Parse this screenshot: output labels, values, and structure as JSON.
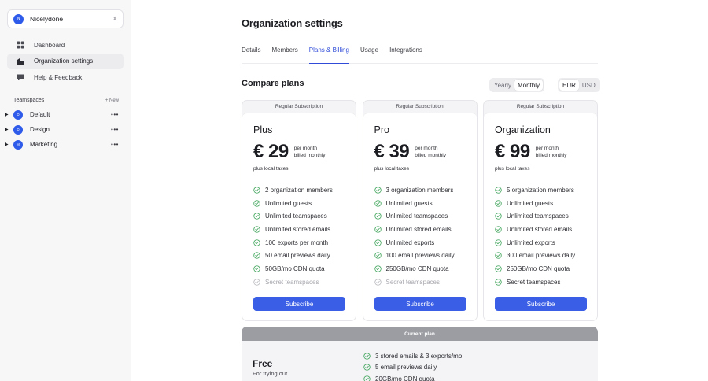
{
  "workspace": {
    "avatar": "N",
    "name": "Nicelydone"
  },
  "nav": [
    {
      "label": "Dashboard",
      "icon": "grid-icon"
    },
    {
      "label": "Organization settings",
      "icon": "building-icon"
    },
    {
      "label": "Help & Feedback",
      "icon": "chat-icon"
    }
  ],
  "teamspaces": {
    "header": "Teamspaces",
    "new_label": "New",
    "items": [
      {
        "badge": "D",
        "label": "Default"
      },
      {
        "badge": "D",
        "label": "Design"
      },
      {
        "badge": "M",
        "label": "Marketing"
      }
    ]
  },
  "page": {
    "title": "Organization settings"
  },
  "tabs": [
    "Details",
    "Members",
    "Plans & Billing",
    "Usage",
    "Integrations"
  ],
  "active_tab": "Plans & Billing",
  "compare": {
    "title": "Compare plans",
    "period_options": [
      "Yearly",
      "Monthly"
    ],
    "period_selected": "Monthly",
    "currency_options": [
      "EUR",
      "USD"
    ],
    "currency_selected": "EUR"
  },
  "plans": [
    {
      "header": "Regular Subscription",
      "name": "Plus",
      "price": "€ 29",
      "per": "per month",
      "billed": "billed monthly",
      "tax": "plus local taxes",
      "features": [
        {
          "text": "2 organization members",
          "on": true
        },
        {
          "text": "Unlimited guests",
          "on": true
        },
        {
          "text": "Unlimited teamspaces",
          "on": true
        },
        {
          "text": "Unlimited stored emails",
          "on": true
        },
        {
          "text": "100 exports per month",
          "on": true
        },
        {
          "text": "50 email previews daily",
          "on": true
        },
        {
          "text": "50GB/mo CDN quota",
          "on": true
        },
        {
          "text": "Secret teamspaces",
          "on": false
        }
      ],
      "button": "Subscribe"
    },
    {
      "header": "Regular Subscription",
      "name": "Pro",
      "price": "€ 39",
      "per": "per month",
      "billed": "billed monthly",
      "tax": "plus local taxes",
      "features": [
        {
          "text": "3 organization members",
          "on": true
        },
        {
          "text": "Unlimited guests",
          "on": true
        },
        {
          "text": "Unlimited teamspaces",
          "on": true
        },
        {
          "text": "Unlimited stored emails",
          "on": true
        },
        {
          "text": "Unlimited exports",
          "on": true
        },
        {
          "text": "100 email previews daily",
          "on": true
        },
        {
          "text": "250GB/mo CDN quota",
          "on": true
        },
        {
          "text": "Secret teamspaces",
          "on": false
        }
      ],
      "button": "Subscribe"
    },
    {
      "header": "Regular Subscription",
      "name": "Organization",
      "price": "€ 99",
      "per": "per month",
      "billed": "billed monthly",
      "tax": "plus local taxes",
      "features": [
        {
          "text": "5 organization members",
          "on": true
        },
        {
          "text": "Unlimited guests",
          "on": true
        },
        {
          "text": "Unlimited teamspaces",
          "on": true
        },
        {
          "text": "Unlimited stored emails",
          "on": true
        },
        {
          "text": "Unlimited exports",
          "on": true
        },
        {
          "text": "300 email previews daily",
          "on": true
        },
        {
          "text": "250GB/mo CDN quota",
          "on": true
        },
        {
          "text": "Secret teamspaces",
          "on": true
        }
      ],
      "button": "Subscribe"
    }
  ],
  "current_plan": {
    "header": "Current plan",
    "name": "Free",
    "subtitle": "For trying out",
    "features": [
      "3 stored emails & 3 exports/mo",
      "5 email previews daily",
      "20GB/mo CDN quota"
    ]
  },
  "colors": {
    "accent": "#3b5ee6",
    "check": "#3fa45b",
    "active_tab": "#2f4bd8"
  }
}
